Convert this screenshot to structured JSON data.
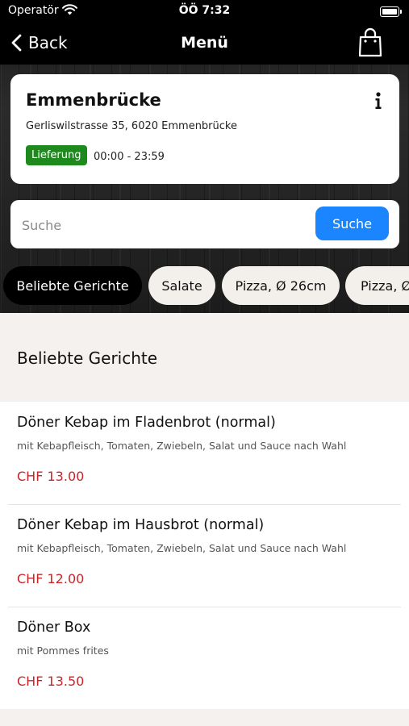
{
  "status_bar": {
    "carrier": "Operatör",
    "time": "ÖÖ 7:32"
  },
  "nav": {
    "back_label": "Back",
    "title": "Menü"
  },
  "store": {
    "name": "Emmenbrücke",
    "address": "Gerliswilstrasse 35, 6020 Emmenbrücke",
    "delivery_badge": "Lieferung",
    "hours": "00:00 - 23:59"
  },
  "search": {
    "placeholder": "Suche",
    "value": "",
    "button_label": "Suche"
  },
  "categories": [
    {
      "label": "Beliebte Gerichte",
      "active": true
    },
    {
      "label": "Salate",
      "active": false
    },
    {
      "label": "Pizza, Ø 26cm",
      "active": false
    },
    {
      "label": "Pizza, Ø",
      "active": false
    }
  ],
  "section": {
    "title": "Beliebte Gerichte"
  },
  "menu_items": [
    {
      "name": "Döner Kebap im Fladenbrot (normal)",
      "description": "mit Kebapfleisch, Tomaten, Zwiebeln, Salat und Sauce nach Wahl",
      "price": "CHF 13.00"
    },
    {
      "name": "Döner Kebap im Hausbrot (normal)",
      "description": "mit Kebapfleisch, Tomaten, Zwiebeln, Salat und Sauce nach Wahl",
      "price": "CHF 12.00"
    },
    {
      "name": "Döner Box",
      "description": "mit Pommes frites",
      "price": "CHF 13.50"
    }
  ],
  "colors": {
    "accent_blue": "#1a85ff",
    "delivery_green": "#1e8a1e",
    "price_red": "#c8252a",
    "active_chip": "#000000"
  },
  "icons": {
    "wifi": "wifi-icon",
    "battery": "battery-icon",
    "back": "chevron-left-icon",
    "cart": "shopping-bag-icon",
    "info": "info-icon"
  }
}
